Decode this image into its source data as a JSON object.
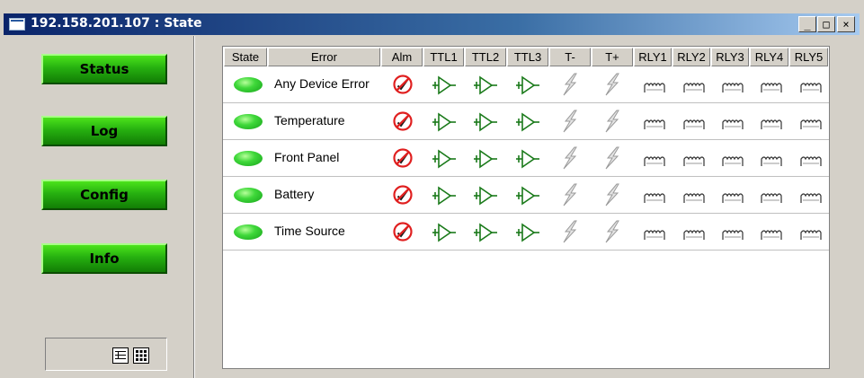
{
  "window": {
    "title": "192.158.201.107 : State",
    "controls": {
      "minimize": "_",
      "maximize": "□",
      "close": "×"
    }
  },
  "nav": {
    "buttons": [
      {
        "label": "Status"
      },
      {
        "label": "Log"
      },
      {
        "label": "Config"
      },
      {
        "label": "Info"
      }
    ],
    "view_icons": [
      "list-view-icon",
      "grid-view-icon"
    ]
  },
  "table": {
    "headers": [
      "State",
      "Error",
      "Alm",
      "TTL1",
      "TTL2",
      "TTL3",
      "T-",
      "T+",
      "RLY1",
      "RLY2",
      "RLY3",
      "RLY4",
      "RLY5"
    ],
    "rows": [
      {
        "state": "ok",
        "error": "Any Device Error"
      },
      {
        "state": "ok",
        "error": "Temperature"
      },
      {
        "state": "ok",
        "error": "Front Panel"
      },
      {
        "state": "ok",
        "error": "Battery"
      },
      {
        "state": "ok",
        "error": "Time Source"
      }
    ],
    "icons": {
      "alm": "alarm-disabled-icon",
      "ttl": "buffer-gate-icon",
      "t": "bolt-icon",
      "rly": "relay-coil-icon"
    }
  },
  "colors": {
    "button_green": "#26b010",
    "led_green": "#3fd83a",
    "title_bar": "#0a246a",
    "alarm_red": "#e02020",
    "gate_green": "#1a7a1a"
  }
}
